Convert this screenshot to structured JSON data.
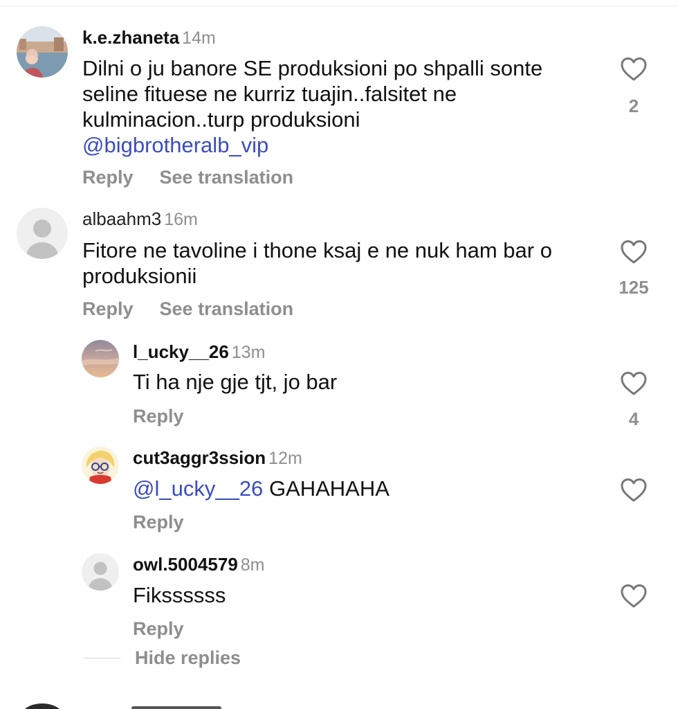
{
  "colors": {
    "mention": "#3b4cc0",
    "secondary_text": "#8e8e8e",
    "primary_text": "#111111"
  },
  "icons": {
    "like": "heart-outline-icon",
    "default_avatar": "default-avatar-icon"
  },
  "comments": [
    {
      "username": "k.e.zhaneta",
      "time": "14m",
      "text": "Dilni o ju banore SE produksioni po shpalli sonte seline fituese ne kurriz tuajin..falsitet ne kulminacion..turp produksioni",
      "mention": "@bigbrotheralb_vip",
      "reply_label": "Reply",
      "translate_label": "See translation",
      "likes": "2"
    },
    {
      "username": "albaahm3",
      "time": "16m",
      "text": "Fitore ne tavoline i thone ksaj e ne nuk ham bar o produksionii",
      "reply_label": "Reply",
      "translate_label": "See translation",
      "likes": "125",
      "replies": [
        {
          "username": "l_ucky__26",
          "time": "13m",
          "text": "Ti ha nje gje tjt, jo bar",
          "reply_label": "Reply",
          "likes": "4"
        },
        {
          "username": "cut3aggr3ssion",
          "time": "12m",
          "mention": "@l_ucky__26",
          "text": "GAHAHAHA",
          "reply_label": "Reply"
        },
        {
          "username": "owl.5004579",
          "time": "8m",
          "text": "Fikssssss",
          "reply_label": "Reply"
        }
      ],
      "hide_replies_label": "Hide replies"
    }
  ]
}
